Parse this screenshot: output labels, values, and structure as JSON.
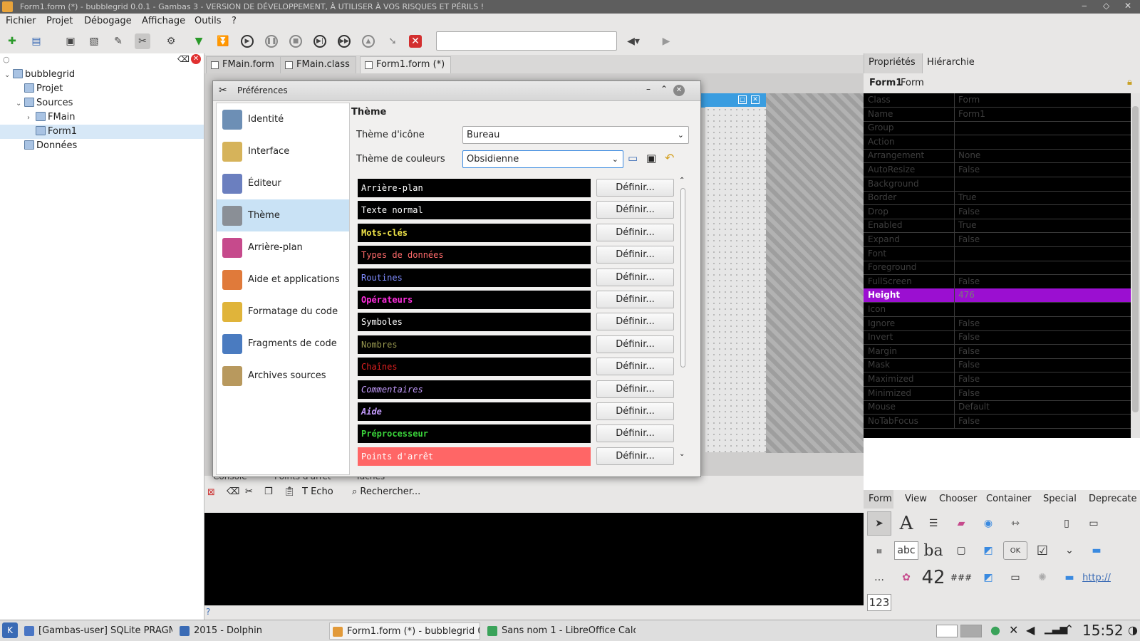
{
  "window": {
    "title": "Form1.form (*) - bubblegrid 0.0.1 - Gambas 3 - VERSION DE DÉVELOPPEMENT, À UTILISER À VOS RISQUES ET PÉRILS !"
  },
  "menu": [
    "Fichier",
    "Projet",
    "Débogage",
    "Affichage",
    "Outils",
    "?"
  ],
  "tree": [
    {
      "label": "bubblegrid",
      "level": 0,
      "twisty": "v"
    },
    {
      "label": "Projet",
      "level": 1,
      "twisty": ""
    },
    {
      "label": "Sources",
      "level": 1,
      "twisty": "v"
    },
    {
      "label": "FMain",
      "level": 2,
      "twisty": ">"
    },
    {
      "label": "Form1",
      "level": 2,
      "twisty": "",
      "selected": true
    },
    {
      "label": "Données",
      "level": 1,
      "twisty": ""
    }
  ],
  "tabs": [
    "FMain.form",
    "FMain.class",
    "Form1.form (*)"
  ],
  "bottom": {
    "tabs": [
      "Console",
      "Points d'arrêt",
      "Tâches"
    ],
    "echo": "Echo",
    "search": "Rechercher..."
  },
  "status": "?",
  "properties": {
    "tabs": [
      "Propriétés",
      "Hiérarchie"
    ],
    "object_name": "Form1",
    "object_class": "Form",
    "rows": [
      {
        "k": "Class",
        "v": "Form"
      },
      {
        "k": "Name",
        "v": "Form1"
      },
      {
        "k": "Group",
        "v": ""
      },
      {
        "k": "Action",
        "v": ""
      },
      {
        "k": "Arrangement",
        "v": "None"
      },
      {
        "k": "AutoResize",
        "v": "False"
      },
      {
        "k": "Background",
        "v": ""
      },
      {
        "k": "Border",
        "v": "True"
      },
      {
        "k": "Drop",
        "v": "False"
      },
      {
        "k": "Enabled",
        "v": "True"
      },
      {
        "k": "Expand",
        "v": "False"
      },
      {
        "k": "Font",
        "v": ""
      },
      {
        "k": "Foreground",
        "v": ""
      },
      {
        "k": "FullScreen",
        "v": "False"
      },
      {
        "k": "Height",
        "v": "476",
        "selected": true
      },
      {
        "k": "Icon",
        "v": ""
      },
      {
        "k": "Ignore",
        "v": "False"
      },
      {
        "k": "Invert",
        "v": "False"
      },
      {
        "k": "Margin",
        "v": "False"
      },
      {
        "k": "Mask",
        "v": "False"
      },
      {
        "k": "Maximized",
        "v": "False"
      },
      {
        "k": "Minimized",
        "v": "False"
      },
      {
        "k": "Mouse",
        "v": "Default"
      },
      {
        "k": "NoTabFocus",
        "v": "False"
      }
    ]
  },
  "toolbox": {
    "tabs": [
      "Form",
      "View",
      "Chooser",
      "Container",
      "Special",
      "Deprecate"
    ],
    "glyphs": [
      "A",
      "abc",
      "42",
      "###",
      "OK",
      "123",
      "http://"
    ]
  },
  "dialog": {
    "title": "Préférences",
    "sidebar": [
      {
        "label": "Identité",
        "color": "#6d8fb5"
      },
      {
        "label": "Interface",
        "color": "#d6b35a"
      },
      {
        "label": "Éditeur",
        "color": "#6b7fbf"
      },
      {
        "label": "Thème",
        "color": "#8a8f96",
        "selected": true
      },
      {
        "label": "Arrière-plan",
        "color": "#c64a8c"
      },
      {
        "label": "Aide et applications",
        "color": "#e07a3a"
      },
      {
        "label": "Formatage du code",
        "color": "#e0b43a"
      },
      {
        "label": "Fragments de code",
        "color": "#4a7bc0"
      },
      {
        "label": "Archives sources",
        "color": "#b8995e"
      }
    ],
    "section_title": "Thème",
    "icon_theme_label": "Thème d'icône",
    "icon_theme_value": "Bureau",
    "color_theme_label": "Thème de couleurs",
    "color_theme_value": "Obsidienne",
    "define_label": "Définir...",
    "colors": [
      {
        "label": "Arrière-plan",
        "fg": "#ffffff",
        "bg": "#000000",
        "bold": false,
        "italic": false
      },
      {
        "label": "Texte normal",
        "fg": "#ffffff",
        "bg": "#000000",
        "bold": false,
        "italic": false
      },
      {
        "label": "Mots-clés",
        "fg": "#f2e64a",
        "bg": "#000000",
        "bold": true,
        "italic": false
      },
      {
        "label": "Types de données",
        "fg": "#ff6a6a",
        "bg": "#000000",
        "bold": false,
        "italic": false
      },
      {
        "label": "Routines",
        "fg": "#7f8cff",
        "bg": "#000000",
        "bold": false,
        "italic": false
      },
      {
        "label": "Opérateurs",
        "fg": "#ff2ee0",
        "bg": "#000000",
        "bold": true,
        "italic": false
      },
      {
        "label": "Symboles",
        "fg": "#ffffff",
        "bg": "#000000",
        "bold": false,
        "italic": false
      },
      {
        "label": "Nombres",
        "fg": "#9a9a50",
        "bg": "#000000",
        "bold": false,
        "italic": false
      },
      {
        "label": "Chaînes",
        "fg": "#e02020",
        "bg": "#000000",
        "bold": false,
        "italic": false
      },
      {
        "label": "Commentaires",
        "fg": "#c59cff",
        "bg": "#000000",
        "bold": false,
        "italic": true
      },
      {
        "label": "Aide",
        "fg": "#c59cff",
        "bg": "#000000",
        "bold": true,
        "italic": true
      },
      {
        "label": "Préprocesseur",
        "fg": "#3ad43a",
        "bg": "#000000",
        "bold": true,
        "italic": false
      },
      {
        "label": "Points d'arrêt",
        "fg": "#ffffff",
        "bg": "#ff6666",
        "bold": false,
        "italic": false
      }
    ]
  },
  "taskbar": {
    "tasks": [
      {
        "label": "[Gambas-user] SQLite PRAGM",
        "color": "#4a76c4"
      },
      {
        "label": "2015 - Dolphin",
        "color": "#3a6bb5"
      },
      {
        "label": "Form1.form (*) - bubblegrid 0",
        "color": "#e29a3a",
        "active": true
      },
      {
        "label": "Sans nom 1 - LibreOffice Calc",
        "color": "#3aa35a"
      }
    ],
    "clock": "15:52"
  }
}
